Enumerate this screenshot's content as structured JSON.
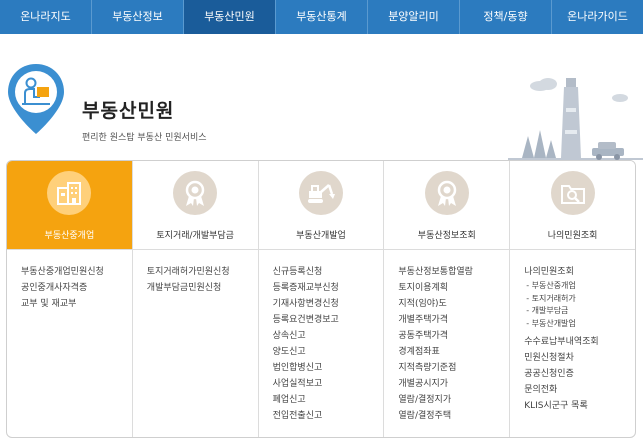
{
  "nav": [
    {
      "label": "온나라지도"
    },
    {
      "label": "부동산정보"
    },
    {
      "label": "부동산민원",
      "active": true
    },
    {
      "label": "부동산통계"
    },
    {
      "label": "분양알리미"
    },
    {
      "label": "정책/동향"
    },
    {
      "label": "온나라가이드"
    }
  ],
  "header": {
    "title": "부동산민원",
    "subtitle": "편리한 원스탑 부동산 민원서비스"
  },
  "colors": {
    "nav": "#2c7bbf",
    "nav_active": "#1a5c9a",
    "accent": "#f5a30f",
    "pin": "#3b8fd1"
  },
  "columns": [
    {
      "label": "부동산중개업",
      "icon": "building-icon",
      "links": [
        "부동산중개업민원신청",
        "공인중개사자격증",
        "교부 및 재교부"
      ]
    },
    {
      "label": "토지거래/개발부담금",
      "icon": "ribbon-award-icon",
      "links": [
        "토지거래허가민원신청",
        "개발부담금민원신청"
      ]
    },
    {
      "label": "부동산개발업",
      "icon": "excavator-icon",
      "links": [
        "신규등록신청",
        "등록증재교부신청",
        "기재사항변경신청",
        "등록요건변경보고",
        "상속신고",
        "양도신고",
        "법인합병신고",
        "사업실적보고",
        "폐업신고",
        "전입전출신고"
      ]
    },
    {
      "label": "부동산정보조회",
      "icon": "ribbon-award-icon",
      "links": [
        "부동산정보통합열람",
        "토지이용계획",
        "지적(임야)도",
        "개별주택가격",
        "공동주택가격",
        "경계점좌표",
        "지적측량기준점",
        "개별공시지가",
        "열람/결정지가",
        "열람/결정주택"
      ]
    },
    {
      "label": "나의민원조회",
      "icon": "folder-search-icon",
      "links": [
        "나의민원조회"
      ],
      "sublinks": [
        "- 부동산중개업",
        "- 토지거래허가",
        "- 개발부담금",
        "- 부동산개발업"
      ],
      "links2": [
        "수수료납부내역조회",
        "민원신청절차",
        "공공신청인증",
        "문의전화",
        "KLIS시군구 목록"
      ]
    }
  ]
}
